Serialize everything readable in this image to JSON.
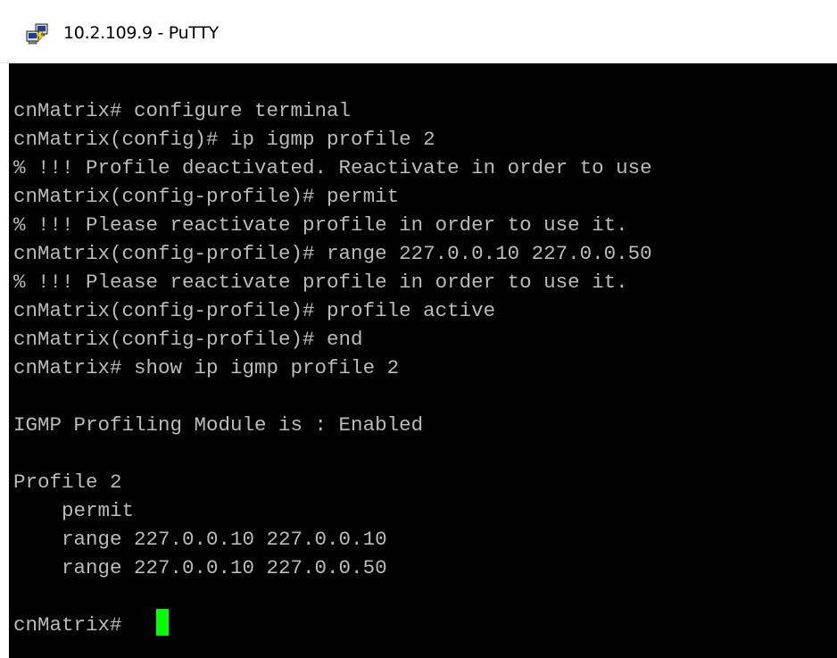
{
  "window": {
    "title": "10.2.109.9 - PuTTY",
    "icon": "putty-icon"
  },
  "terminal": {
    "foreground": "#bbbbbb",
    "background": "#000000",
    "cursor_color": "#00ff00",
    "lines": [
      "cnMatrix# configure terminal",
      "cnMatrix(config)# ip igmp profile 2",
      "% !!! Profile deactivated. Reactivate in order to use",
      "cnMatrix(config-profile)# permit",
      "% !!! Please reactivate profile in order to use it.",
      "cnMatrix(config-profile)# range 227.0.0.10 227.0.0.50",
      "% !!! Please reactivate profile in order to use it.",
      "cnMatrix(config-profile)# profile active",
      "cnMatrix(config-profile)# end",
      "cnMatrix# show ip igmp profile 2",
      "",
      "IGMP Profiling Module is : Enabled",
      "",
      "Profile 2",
      "    permit",
      "    range 227.0.0.10 227.0.0.10",
      "    range 227.0.0.10 227.0.0.50",
      ""
    ],
    "prompt": "cnMatrix# "
  }
}
